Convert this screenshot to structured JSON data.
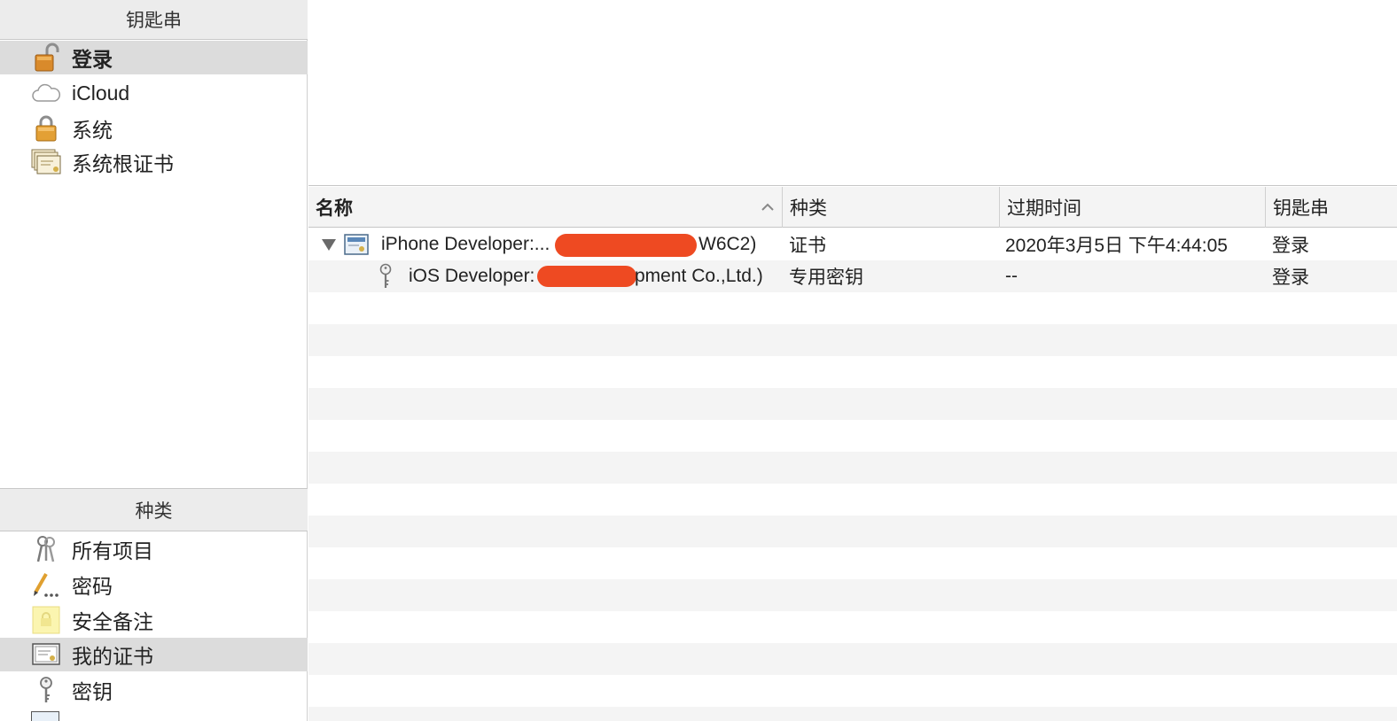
{
  "sidebar": {
    "keychains_header": "钥匙串",
    "keychains": [
      {
        "label": "登录",
        "icon": "unlocked-padlock-icon",
        "selected": true
      },
      {
        "label": "iCloud",
        "icon": "cloud-icon",
        "selected": false
      },
      {
        "label": "系统",
        "icon": "padlock-icon",
        "selected": false
      },
      {
        "label": "系统根证书",
        "icon": "certificates-icon",
        "selected": false
      }
    ],
    "category_header": "种类",
    "categories": [
      {
        "label": "所有项目",
        "icon": "keys-icon",
        "selected": false
      },
      {
        "label": "密码",
        "icon": "pencil-icon",
        "selected": false
      },
      {
        "label": "安全备注",
        "icon": "secure-note-icon",
        "selected": false
      },
      {
        "label": "我的证书",
        "icon": "certificate-icon",
        "selected": true
      },
      {
        "label": "密钥",
        "icon": "key-icon",
        "selected": false
      }
    ]
  },
  "table": {
    "columns": {
      "name": "名称",
      "kind": "种类",
      "expiry": "过期时间",
      "keychain": "钥匙串"
    },
    "sort_column": "name",
    "sort_direction": "ascending",
    "rows": [
      {
        "name_prefix": "iPhone Developer:...",
        "name_suffix": "W6C2)",
        "kind": "证书",
        "expiry": "2020年3月5日 下午4:44:05",
        "keychain": "登录",
        "icon": "certificate-icon",
        "expanded": true
      },
      {
        "name_prefix": "iOS Developer:",
        "name_suffix": "pment Co.,Ltd.)",
        "kind": "专用密钥",
        "expiry": "--",
        "keychain": "登录",
        "icon": "key-icon"
      }
    ]
  },
  "colors": {
    "redaction": "#ee4a22",
    "selection": "#dcdcdc",
    "stripe": "#f4f4f4"
  }
}
